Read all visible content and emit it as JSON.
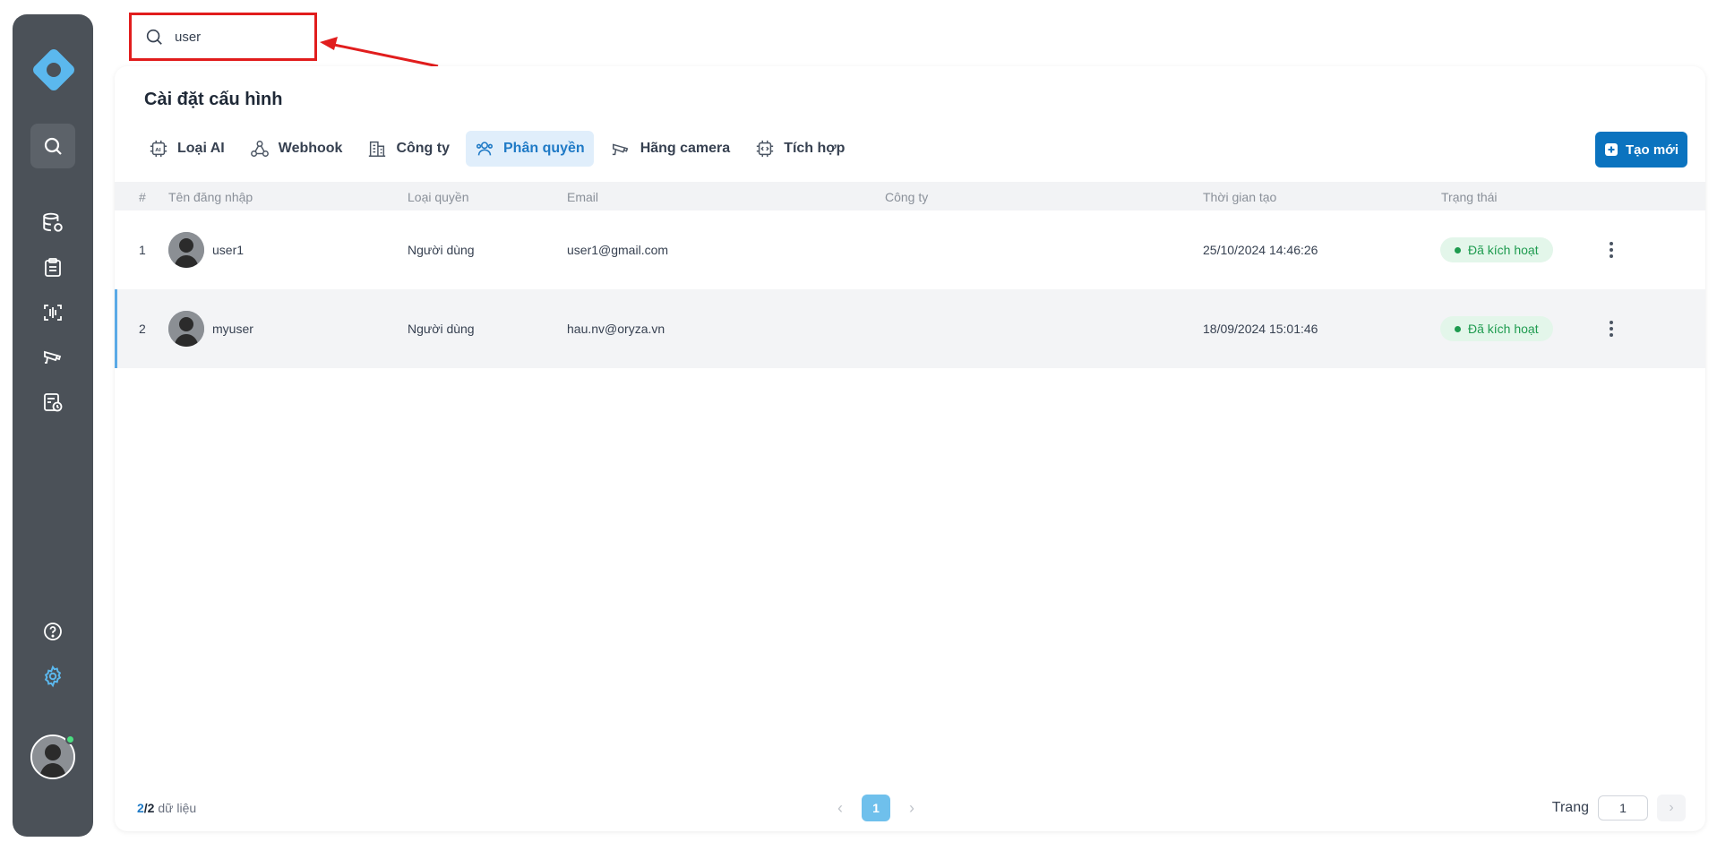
{
  "search": {
    "value": "user",
    "placeholder": ""
  },
  "page_title": "Cài đặt cấu hình",
  "tabs": [
    {
      "label": "Loại AI",
      "icon": "ai-chip-icon"
    },
    {
      "label": "Webhook",
      "icon": "webhook-icon"
    },
    {
      "label": "Công ty",
      "icon": "building-icon"
    },
    {
      "label": "Phân quyền",
      "icon": "users-permission-icon",
      "active": true
    },
    {
      "label": "Hãng camera",
      "icon": "cctv-camera-icon"
    },
    {
      "label": "Tích hợp",
      "icon": "integration-chip-icon"
    }
  ],
  "create_button": {
    "label": "Tạo mới"
  },
  "table": {
    "headers": [
      "#",
      "Tên đăng nhập",
      "Loại quyền",
      "Email",
      "Công ty",
      "Thời gian tạo",
      "Trạng thái"
    ],
    "rows": [
      {
        "index": "1",
        "username": "user1",
        "role": "Người dùng",
        "email": "user1@gmail.com",
        "company": "",
        "created": "25/10/2024 14:46:26",
        "status": "Đã kích hoạt"
      },
      {
        "index": "2",
        "username": "myuser",
        "role": "Người dùng",
        "email": "hau.nv@oryza.vn",
        "company": "",
        "created": "18/09/2024 15:01:46",
        "status": "Đã kích hoạt"
      }
    ]
  },
  "footer": {
    "shown": "2",
    "total": "/2",
    "suffix": " dữ liệu",
    "current_page": "1",
    "goto_label": "Trang",
    "goto_value": "1"
  },
  "colors": {
    "sidebar": "#4b5158",
    "accent": "#0b73bf",
    "active_tab_bg": "#e0eefb",
    "status_green": "#1e9b4f",
    "highlight_red": "#e11d1d"
  }
}
